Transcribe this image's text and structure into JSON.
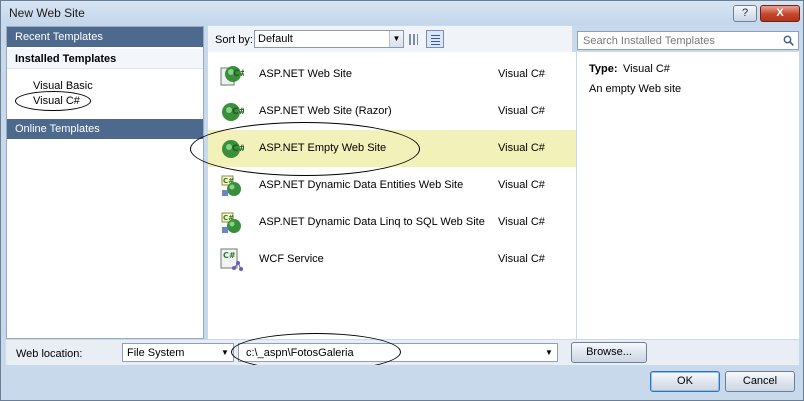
{
  "window": {
    "title": "New Web Site",
    "help_label": "?",
    "close_label": "X"
  },
  "sidebar": {
    "recent_label": "Recent Templates",
    "installed_label": "Installed Templates",
    "items": [
      {
        "label": "Visual Basic"
      },
      {
        "label": "Visual C#"
      }
    ],
    "online_label": "Online Templates"
  },
  "toolbar": {
    "sort_label": "Sort by:",
    "sort_value": "Default"
  },
  "templates": [
    {
      "name": "ASP.NET Web Site",
      "language": "Visual C#",
      "icon": "globe-csharp-icon"
    },
    {
      "name": "ASP.NET Web Site (Razor)",
      "language": "Visual C#",
      "icon": "globe-csharp-icon"
    },
    {
      "name": "ASP.NET Empty Web Site",
      "language": "Visual C#",
      "icon": "globe-csharp-icon"
    },
    {
      "name": "ASP.NET Dynamic Data Entities Web Site",
      "language": "Visual C#",
      "icon": "dynamic-data-icon"
    },
    {
      "name": "ASP.NET Dynamic Data Linq to SQL Web Site",
      "language": "Visual C#",
      "icon": "dynamic-data-icon"
    },
    {
      "name": "WCF Service",
      "language": "Visual C#",
      "icon": "wcf-service-icon"
    }
  ],
  "search": {
    "placeholder": "Search Installed Templates"
  },
  "details": {
    "type_label": "Type:",
    "type_value": "Visual C#",
    "description": "An empty Web site"
  },
  "location": {
    "label": "Web location:",
    "type_value": "File System",
    "path_value": "c:\\_aspn\\FotosGaleria",
    "browse_label": "Browse..."
  },
  "buttons": {
    "ok_label": "OK",
    "cancel_label": "Cancel"
  },
  "colors": {
    "selected_row": "#f2f1b9",
    "header_blue": "#4d6a8e"
  }
}
